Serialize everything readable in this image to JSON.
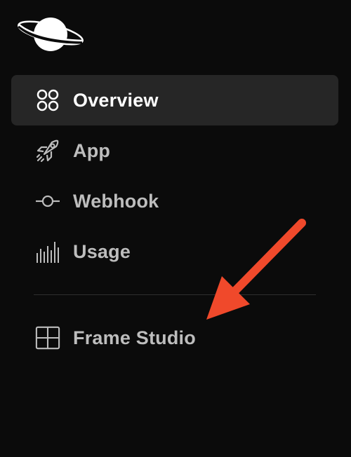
{
  "brand": {
    "logo_icon": "planet-icon"
  },
  "nav": {
    "items": [
      {
        "label": "Overview",
        "icon": "grid-circles-icon",
        "active": true
      },
      {
        "label": "App",
        "icon": "rocket-icon",
        "active": false
      },
      {
        "label": "Webhook",
        "icon": "commit-icon",
        "active": false
      },
      {
        "label": "Usage",
        "icon": "bars-icon",
        "active": false
      }
    ],
    "secondary": [
      {
        "label": "Frame Studio",
        "icon": "frame-grid-icon",
        "active": false
      }
    ]
  },
  "annotation": {
    "icon": "arrow-icon",
    "color": "#f0492b"
  },
  "colors": {
    "background": "#0b0b0b",
    "active_bg": "#262626",
    "text": "#bdbdbd",
    "text_active": "#ffffff"
  }
}
